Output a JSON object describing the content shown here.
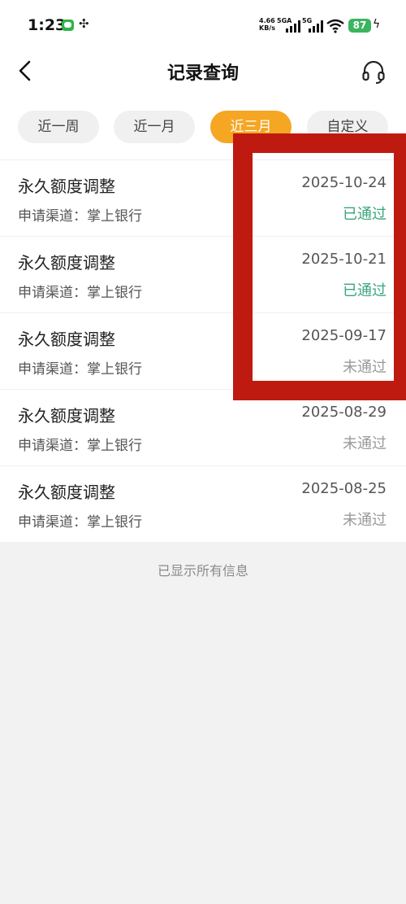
{
  "status_bar": {
    "time": "1:23",
    "app_icon": "sim-icon",
    "speed_value": "4.66",
    "speed_unit": "KB/s",
    "net1": "5GA",
    "net2": "5G",
    "battery": "87",
    "accent_battery": "#3bb55f"
  },
  "header": {
    "title": "记录查询",
    "back_icon": "chevron-left-icon",
    "service_icon": "headset-icon"
  },
  "tabs": [
    {
      "label": "近一周",
      "active": false
    },
    {
      "label": "近一月",
      "active": false
    },
    {
      "label": "近三月",
      "active": true
    },
    {
      "label": "自定义",
      "active": false
    }
  ],
  "records": [
    {
      "title": "永久额度调整",
      "date": "2025-10-24",
      "channel": "申请渠道：掌上银行",
      "status": "已通过"
    },
    {
      "title": "永久额度调整",
      "date": "2025-10-21",
      "channel": "申请渠道：掌上银行",
      "status": "已通过"
    },
    {
      "title": "永久额度调整",
      "date": "2025-09-17",
      "channel": "申请渠道：掌上银行",
      "status": "未通过"
    },
    {
      "title": "永久额度调整",
      "date": "2025-08-29",
      "channel": "申请渠道：掌上银行",
      "status": "未通过"
    },
    {
      "title": "永久额度调整",
      "date": "2025-08-25",
      "channel": "申请渠道：掌上银行",
      "status": "未通过"
    }
  ],
  "end_note": "已显示所有信息",
  "colors": {
    "tab_active": "#f5a623",
    "status_pass": "#3aa57c",
    "status_fail": "#9a9a9a",
    "highlight_box": "#bf1a0f"
  }
}
